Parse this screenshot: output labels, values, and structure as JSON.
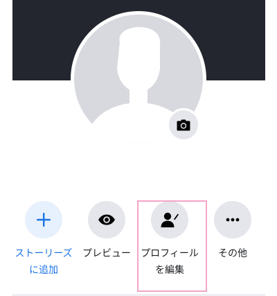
{
  "colors": {
    "cover": "#23262f",
    "avatar_placeholder": "#d8d9de",
    "icon_bg": "#e4e6eb",
    "accent_blue": "#1b74e4",
    "highlight_pink": "#f3a6c8"
  },
  "profile": {
    "avatar_icon": "default-silhouette-icon",
    "camera_icon": "camera-icon"
  },
  "actions": [
    {
      "id": "story",
      "icon": "plus-icon",
      "line1": "ストーリーズ",
      "line2": "に追加"
    },
    {
      "id": "preview",
      "icon": "eye-icon",
      "line1": "プレビュー",
      "line2": ""
    },
    {
      "id": "edit-profile",
      "icon": "person-edit-icon",
      "line1": "プロフィール",
      "line2": "を編集"
    },
    {
      "id": "more",
      "icon": "more-dots-icon",
      "line1": "その他",
      "line2": ""
    }
  ]
}
